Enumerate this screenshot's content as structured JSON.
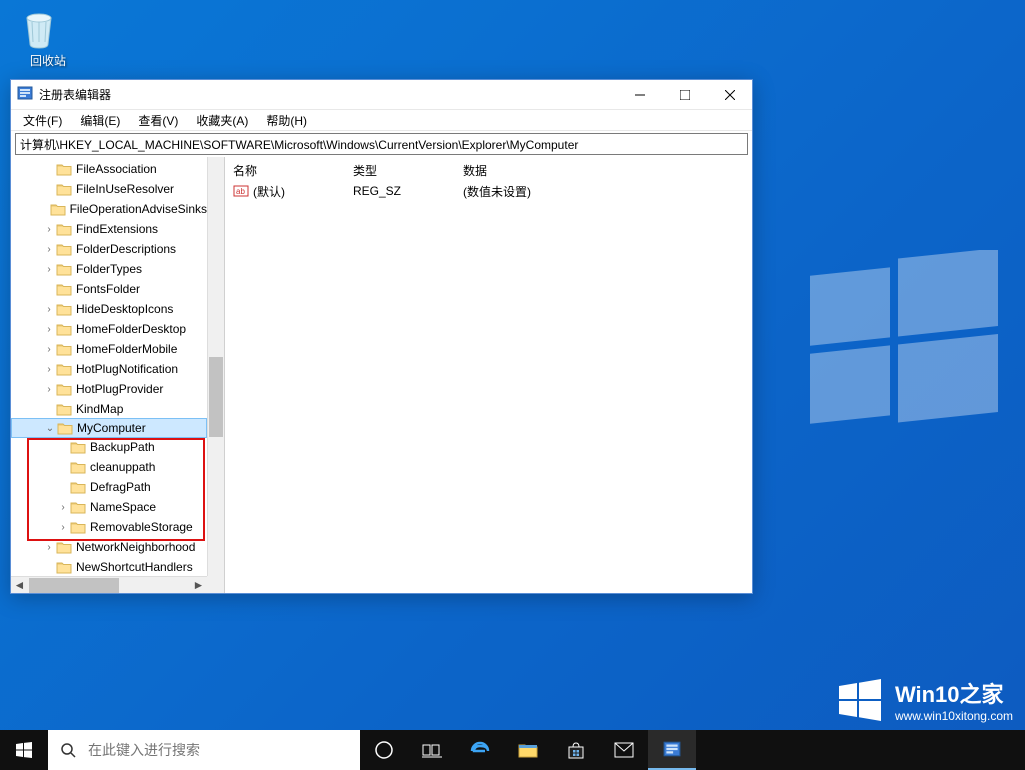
{
  "desktop": {
    "recycle_bin_label": "回收站"
  },
  "window": {
    "title": "注册表编辑器",
    "menu": {
      "file": "文件(F)",
      "edit": "编辑(E)",
      "view": "查看(V)",
      "favorites": "收藏夹(A)",
      "help": "帮助(H)"
    },
    "address": "计算机\\HKEY_LOCAL_MACHINE\\SOFTWARE\\Microsoft\\Windows\\CurrentVersion\\Explorer\\MyComputer",
    "tree": {
      "items": [
        {
          "label": "FileAssociation",
          "indent": 2,
          "exp": ""
        },
        {
          "label": "FileInUseResolver",
          "indent": 2,
          "exp": ""
        },
        {
          "label": "FileOperationAdviseSinks",
          "indent": 2,
          "exp": ""
        },
        {
          "label": "FindExtensions",
          "indent": 2,
          "exp": ">"
        },
        {
          "label": "FolderDescriptions",
          "indent": 2,
          "exp": ">"
        },
        {
          "label": "FolderTypes",
          "indent": 2,
          "exp": ">"
        },
        {
          "label": "FontsFolder",
          "indent": 2,
          "exp": ""
        },
        {
          "label": "HideDesktopIcons",
          "indent": 2,
          "exp": ">"
        },
        {
          "label": "HomeFolderDesktop",
          "indent": 2,
          "exp": ">"
        },
        {
          "label": "HomeFolderMobile",
          "indent": 2,
          "exp": ">"
        },
        {
          "label": "HotPlugNotification",
          "indent": 2,
          "exp": ">"
        },
        {
          "label": "HotPlugProvider",
          "indent": 2,
          "exp": ">"
        },
        {
          "label": "KindMap",
          "indent": 2,
          "exp": ""
        },
        {
          "label": "MyComputer",
          "indent": 2,
          "exp": "v",
          "selected": true
        },
        {
          "label": "BackupPath",
          "indent": 3,
          "exp": ""
        },
        {
          "label": "cleanuppath",
          "indent": 3,
          "exp": ""
        },
        {
          "label": "DefragPath",
          "indent": 3,
          "exp": ""
        },
        {
          "label": "NameSpace",
          "indent": 3,
          "exp": ">"
        },
        {
          "label": "RemovableStorage",
          "indent": 3,
          "exp": ">"
        },
        {
          "label": "NetworkNeighborhood",
          "indent": 2,
          "exp": ">"
        },
        {
          "label": "NewShortcutHandlers",
          "indent": 2,
          "exp": ""
        }
      ]
    },
    "list": {
      "headers": {
        "name": "名称",
        "type": "类型",
        "data": "数据"
      },
      "rows": [
        {
          "name": "(默认)",
          "type": "REG_SZ",
          "data": "(数值未设置)"
        }
      ]
    }
  },
  "taskbar": {
    "search_placeholder": "在此键入进行搜索"
  },
  "watermark": {
    "line1": "Win10之家",
    "line2": "www.win10xitong.com"
  },
  "colors": {
    "folder_fill": "#ffe29a",
    "folder_stroke": "#d9b65a"
  }
}
